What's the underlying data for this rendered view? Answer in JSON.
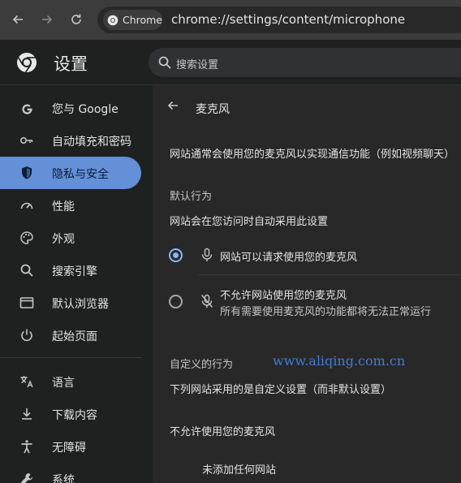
{
  "browser": {
    "back_icon": "arrow-left-icon",
    "forward_icon": "arrow-right-icon",
    "reload_icon": "reload-icon",
    "site_chip_label": "Chrome",
    "url": "chrome://settings/content/microphone"
  },
  "header": {
    "title": "设置",
    "search_placeholder": "搜索设置"
  },
  "sidebar": {
    "items": [
      {
        "label": "您与 Google",
        "icon": "google-icon"
      },
      {
        "label": "自动填充和密码",
        "icon": "key-icon"
      },
      {
        "label": "隐私与安全",
        "icon": "shield-icon"
      },
      {
        "label": "性能",
        "icon": "speedometer-icon"
      },
      {
        "label": "外观",
        "icon": "palette-icon"
      },
      {
        "label": "搜索引擎",
        "icon": "search-icon"
      },
      {
        "label": "默认浏览器",
        "icon": "browser-window-icon"
      },
      {
        "label": "起始页面",
        "icon": "power-icon"
      },
      {
        "label": "语言",
        "icon": "translate-icon"
      },
      {
        "label": "下载内容",
        "icon": "download-icon"
      },
      {
        "label": "无障碍",
        "icon": "accessibility-icon"
      },
      {
        "label": "系统",
        "icon": "wrench-icon"
      }
    ],
    "active_index": 2,
    "active_color": "#6390d6"
  },
  "main": {
    "title": "麦克风",
    "description": "网站通常会使用您的麦克风以实现通信功能（例如视频聊天）",
    "default_behavior": {
      "heading": "默认行为",
      "subheading": "网站会在您访问时自动采用此设置",
      "options": [
        {
          "title": "网站可以请求使用您的麦克风",
          "subtitle": "",
          "icon": "microphone-icon",
          "selected": true
        },
        {
          "title": "不允许网站使用您的麦克风",
          "subtitle": "所有需要使用麦克风的功能都将无法正常运行",
          "icon": "microphone-off-icon",
          "selected": false
        }
      ]
    },
    "custom_behavior": {
      "heading": "自定义的行为",
      "subheading": "下列网站采用的是自定义设置（而非默认设置）"
    },
    "blocked_section": {
      "heading": "不允许使用您的麦克风",
      "empty_message": "未添加任何网站"
    },
    "watermark": "www.aliqing.com.cn"
  },
  "colors": {
    "accent": "#8ab4f8",
    "toolbar": "#3c3c3c",
    "content_bg": "#282828",
    "watermark": "#3c7de0"
  }
}
